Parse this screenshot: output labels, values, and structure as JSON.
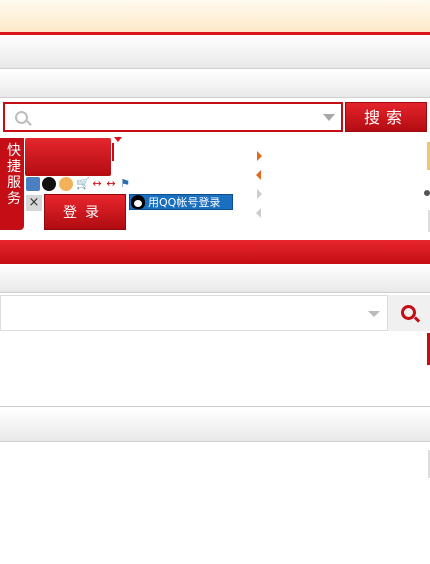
{
  "search": {
    "placeholder": "",
    "button": "搜索"
  },
  "quick_service": {
    "chars": [
      "快",
      "捷",
      "服",
      "务"
    ]
  },
  "login": {
    "close": "×",
    "button": "登录",
    "qq_button": "用QQ帐号登录"
  },
  "search2": {
    "placeholder": ""
  },
  "colors": {
    "brand_red": "#c40d14",
    "qq_blue": "#1a6fc0",
    "orange": "#e06b1a"
  }
}
